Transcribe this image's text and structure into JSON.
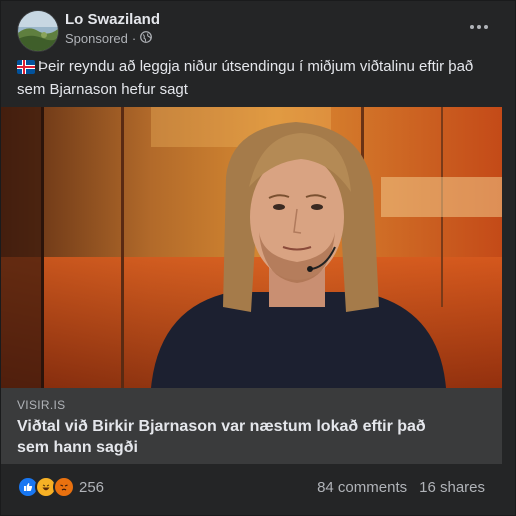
{
  "post": {
    "page_name": "Lo Swaziland",
    "sponsored_label": "Sponsored",
    "privacy_sep": "·",
    "caption": "Þeir reyndu að leggja niður útsendingu í miðjum viðtalinu eftir það sem Bjarnason hefur sagt"
  },
  "link_preview": {
    "domain": "VISIR.IS",
    "title": "Viðtal við Birkir Bjarnason var næstum lokað eftir það sem hann sagði"
  },
  "stats": {
    "reaction_count": "256",
    "comments": "84 comments",
    "shares": "16 shares"
  },
  "icons": {
    "avatar": "avatar-landscape",
    "privacy": "globe-icon",
    "more": "ellipsis-icon",
    "flag": "iceland-flag-icon",
    "reactions": [
      "like-icon",
      "haha-icon",
      "angry-icon"
    ]
  },
  "colors": {
    "card_bg": "#242526",
    "like": "#1877f2",
    "haha": "#f7b125",
    "angry": "#e9710f"
  }
}
